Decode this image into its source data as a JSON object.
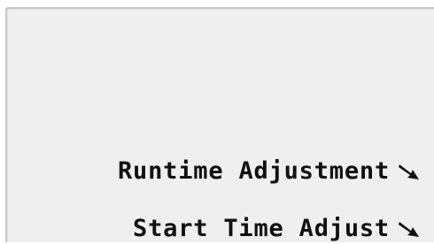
{
  "menu": {
    "items": [
      {
        "label": "Runtime Adjustment",
        "icon": "diagonal-arrow-down-right-icon"
      },
      {
        "label": "Start Time Adjust",
        "icon": "diagonal-arrow-down-right-icon"
      }
    ]
  },
  "colors": {
    "screen_background": "#efefef",
    "text": "#111111",
    "bezel": "#c8c8c8"
  }
}
